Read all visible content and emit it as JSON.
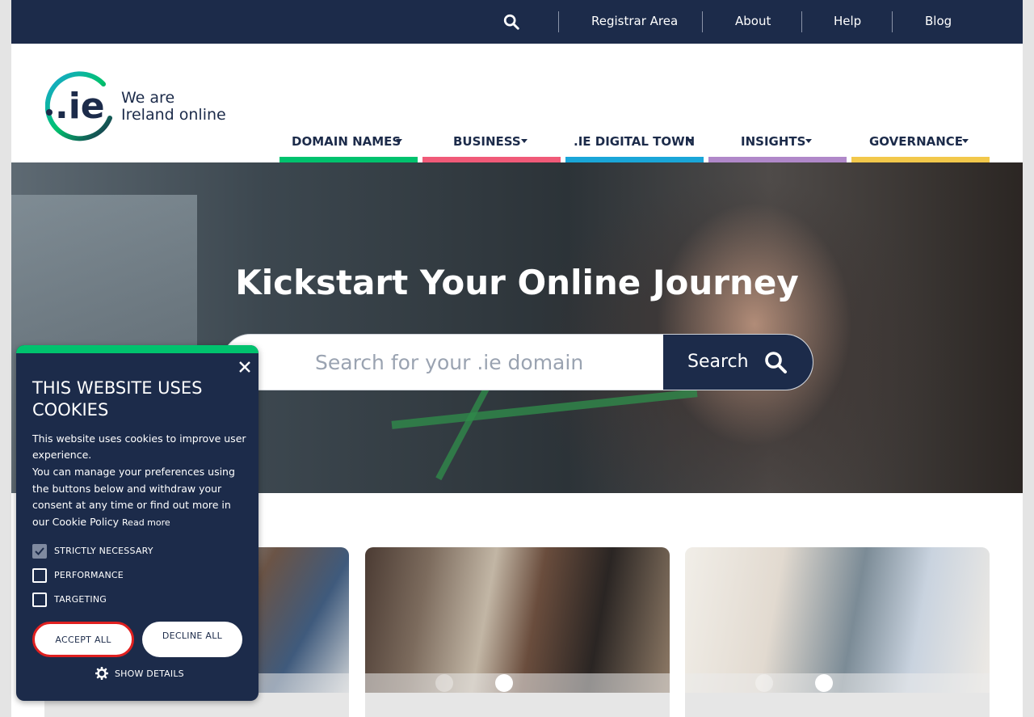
{
  "topbar": {
    "links": [
      "Registrar Area",
      "About",
      "Help",
      "Blog"
    ]
  },
  "logo": {
    "mark_text": ".ie",
    "tagline_line1": "We are",
    "tagline_line2": "Ireland online"
  },
  "nav": {
    "items": [
      {
        "label": "DOMAIN NAMES",
        "color": "#00c26e"
      },
      {
        "label": "BUSINESS",
        "color": "#f05a78"
      },
      {
        "label": ".IE DIGITAL TOWN",
        "color": "#1aa6d8"
      },
      {
        "label": "INSIGHTS",
        "color": "#b088c9"
      },
      {
        "label": "GOVERNANCE",
        "color": "#f2c84b"
      }
    ]
  },
  "hero": {
    "heading": "Kickstart Your Online Journey",
    "search_placeholder": "Search for your .ie domain",
    "search_button": "Search"
  },
  "cookie": {
    "title": "THIS WEBSITE USES COOKIES",
    "text1": "This website uses cookies to improve user experience.",
    "text2": "You can manage your preferences using the buttons below and withdraw your consent at any time or find out more in our Cookie Policy",
    "read_more": "Read more",
    "options": [
      {
        "label": "STRICTLY NECESSARY",
        "checked": true
      },
      {
        "label": "PERFORMANCE",
        "checked": false
      },
      {
        "label": "TARGETING",
        "checked": false
      }
    ],
    "accept_label": "ACCEPT ALL",
    "decline_label": "DECLINE ALL",
    "details_label": "SHOW DETAILS"
  },
  "colors": {
    "navy": "#1c2b4a",
    "accent_green": "#00c26e",
    "accept_border": "#e02020"
  }
}
